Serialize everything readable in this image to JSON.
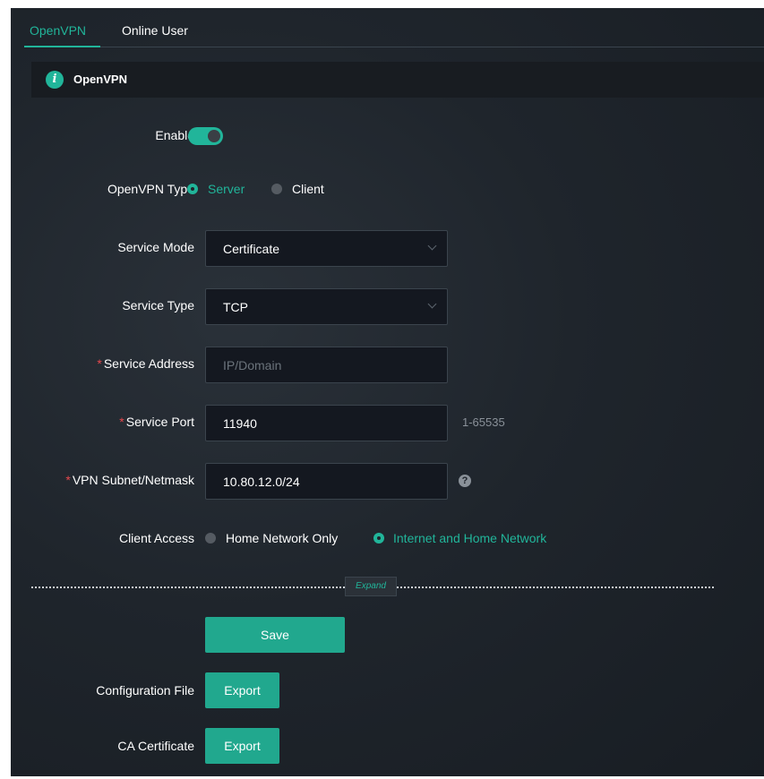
{
  "tabs": {
    "openvpn": "OpenVPN",
    "online_user": "Online User"
  },
  "section": {
    "title": "OpenVPN"
  },
  "form": {
    "enable": {
      "label": "Enable",
      "value": true
    },
    "openvpn_type": {
      "label": "OpenVPN Type",
      "options": [
        "Server",
        "Client"
      ],
      "selected": "Server"
    },
    "service_mode": {
      "label": "Service Mode",
      "value": "Certificate"
    },
    "service_type": {
      "label": "Service Type",
      "value": "TCP"
    },
    "service_address": {
      "required_mark": "*",
      "label": "Service Address",
      "value": "",
      "placeholder": "IP/Domain"
    },
    "service_port": {
      "required_mark": "*",
      "label": "Service Port",
      "value": "11940",
      "hint": "1-65535"
    },
    "vpn_subnet": {
      "required_mark": "*",
      "label": "VPN Subnet/Netmask",
      "value": "10.80.12.0/24",
      "help_icon": "?"
    },
    "client_access": {
      "label": "Client Access",
      "options": [
        "Home Network Only",
        "Internet and Home Network"
      ],
      "selected": "Internet and Home Network"
    }
  },
  "expand_label": "Expand",
  "save_label": "Save",
  "config_file": {
    "label": "Configuration File",
    "button": "Export"
  },
  "ca_certificate": {
    "label": "CA Certificate",
    "button": "Export"
  },
  "colors": {
    "accent": "#21b59a",
    "background": "#1f252c",
    "required": "#e5484d"
  }
}
